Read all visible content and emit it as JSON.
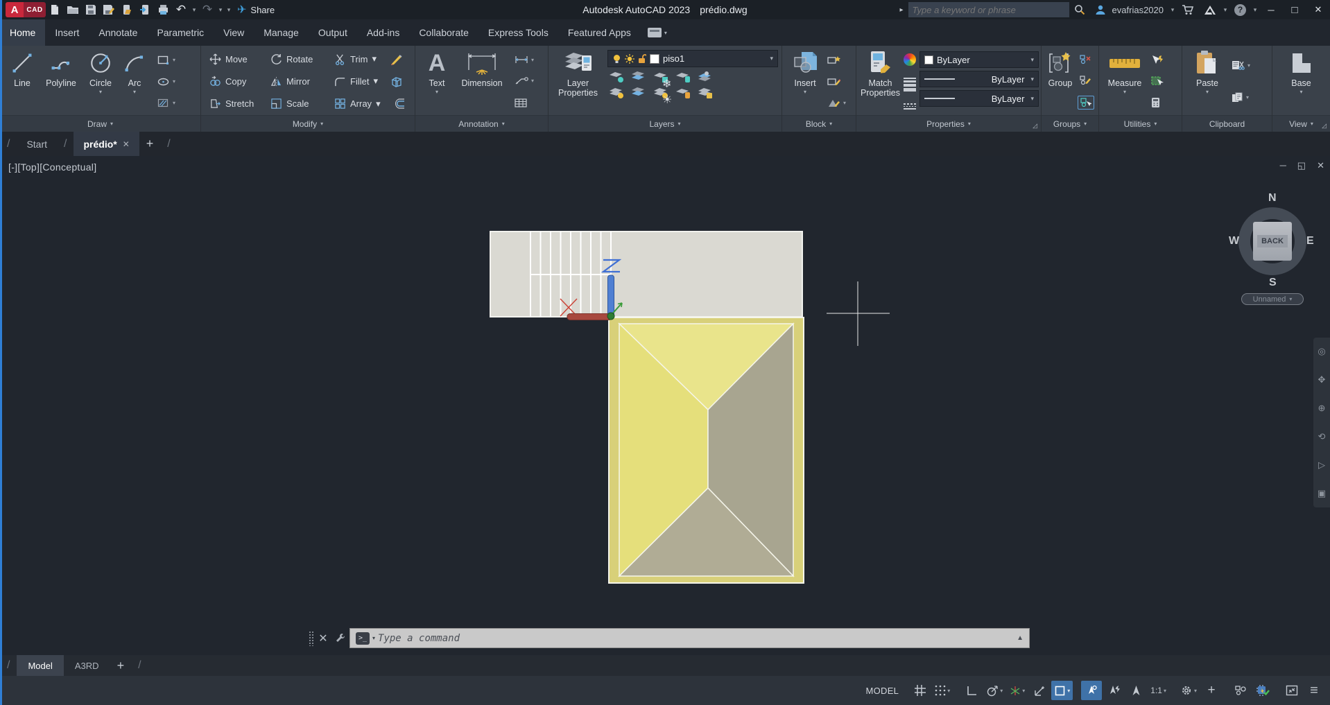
{
  "titlebar": {
    "app_title": "Autodesk AutoCAD 2023",
    "doc_title": "prédio.dwg",
    "share_label": "Share",
    "search_placeholder": "Type a keyword or phrase",
    "username": "evafrias2020"
  },
  "glyphs": {
    "caret": "▾",
    "caret_up": "▲",
    "caret_right": "▸",
    "slash": "/",
    "close": "✕",
    "minimize": "─",
    "maximize": "□",
    "restore": "◱",
    "plus": "+",
    "menu": "≡",
    "expand": "◿",
    "undo": "↶",
    "redo": "↷",
    "plane": "✈",
    "question": "?",
    "prompt": ">_",
    "x_mark": "✕"
  },
  "ribbon": {
    "tabs": [
      "Home",
      "Insert",
      "Annotate",
      "Parametric",
      "View",
      "Manage",
      "Output",
      "Add-ins",
      "Collaborate",
      "Express Tools",
      "Featured Apps"
    ],
    "panels": {
      "draw": {
        "title": "Draw",
        "line": "Line",
        "polyline": "Polyline",
        "circle": "Circle",
        "arc": "Arc"
      },
      "modify": {
        "title": "Modify",
        "move": "Move",
        "rotate": "Rotate",
        "trim": "Trim",
        "copy": "Copy",
        "mirror": "Mirror",
        "fillet": "Fillet",
        "stretch": "Stretch",
        "scale": "Scale",
        "array": "Array"
      },
      "annotation": {
        "title": "Annotation",
        "text": "Text",
        "dimension": "Dimension"
      },
      "layers": {
        "title": "Layers",
        "big": "Layer Properties",
        "layer_name": "piso1"
      },
      "block": {
        "title": "Block",
        "big": "Insert"
      },
      "properties": {
        "title": "Properties",
        "big": "Match Properties",
        "color": "ByLayer",
        "lineweight": "ByLayer",
        "linetype": "ByLayer"
      },
      "groups": {
        "title": "Groups",
        "big": "Group"
      },
      "utilities": {
        "title": "Utilities",
        "big": "Measure"
      },
      "clipboard": {
        "title": "Clipboard",
        "big": "Paste"
      },
      "view": {
        "title": "View",
        "big": "Base"
      }
    }
  },
  "file_tabs": {
    "start": "Start",
    "doc": "prédio*"
  },
  "viewport": {
    "label": "[-][Top][Conceptual]"
  },
  "viewcube": {
    "n": "N",
    "s": "S",
    "e": "E",
    "w": "W",
    "center": "BACK",
    "views": "Unnamed"
  },
  "command": {
    "placeholder": "Type a command"
  },
  "model_tabs": {
    "model": "Model",
    "layout": "A3RD"
  },
  "statusbar": {
    "model_label": "MODEL",
    "scale": "1:1"
  },
  "drawing": {
    "colors": {
      "stairs_fill": "#dad9d2",
      "roof_band": "#d8d079",
      "roof_top": "#e9e48b",
      "roof_left": "#e5df7b",
      "roof_right": "#a8a590",
      "roof_bottom": "#b0ac95"
    }
  }
}
